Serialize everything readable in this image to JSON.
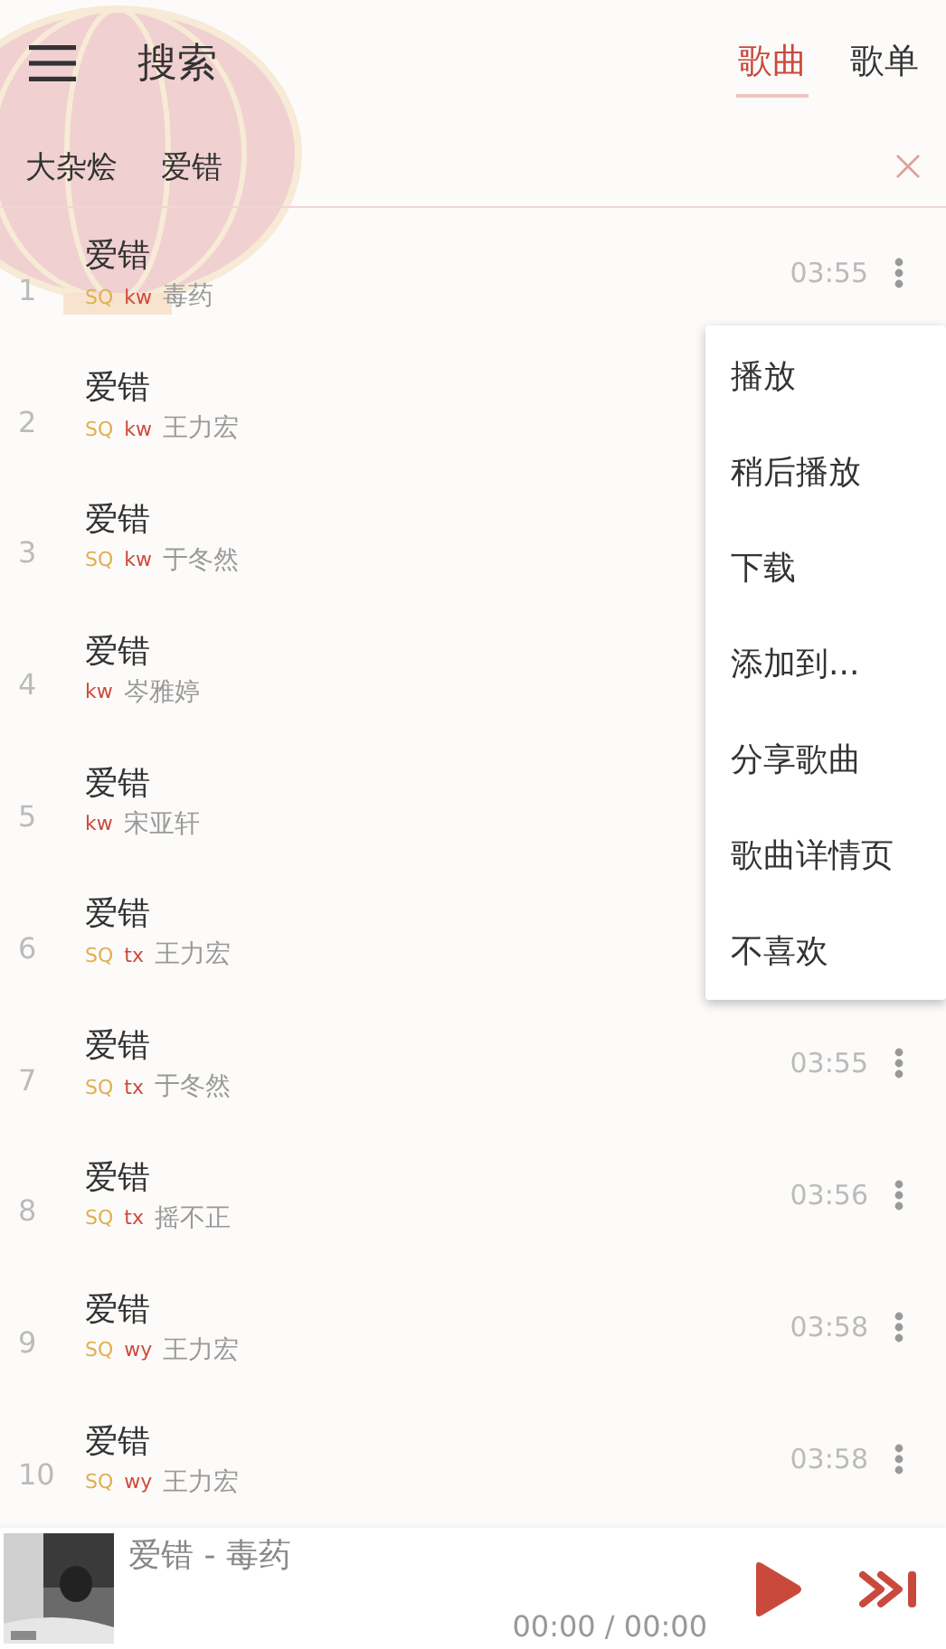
{
  "header": {
    "title": "搜索",
    "tabs": [
      {
        "label": "歌曲",
        "selected": true
      },
      {
        "label": "歌单",
        "selected": false
      }
    ]
  },
  "search_tags": [
    "大杂烩",
    "爱错"
  ],
  "songs": [
    {
      "index": "1",
      "title": "爱错",
      "tags": [
        {
          "kind": "quality",
          "text": "SQ"
        },
        {
          "kind": "source",
          "text": "kw"
        }
      ],
      "artist": "毒药",
      "duration": "03:55"
    },
    {
      "index": "2",
      "title": "爱错",
      "tags": [
        {
          "kind": "quality",
          "text": "SQ"
        },
        {
          "kind": "source",
          "text": "kw"
        }
      ],
      "artist": "王力宏"
    },
    {
      "index": "3",
      "title": "爱错",
      "tags": [
        {
          "kind": "quality",
          "text": "SQ"
        },
        {
          "kind": "source",
          "text": "kw"
        }
      ],
      "artist": "于冬然"
    },
    {
      "index": "4",
      "title": "爱错",
      "tags": [
        {
          "kind": "source",
          "text": "kw"
        }
      ],
      "artist": "岑雅婷"
    },
    {
      "index": "5",
      "title": "爱错",
      "tags": [
        {
          "kind": "source",
          "text": "kw"
        }
      ],
      "artist": "宋亚轩"
    },
    {
      "index": "6",
      "title": "爱错",
      "tags": [
        {
          "kind": "quality",
          "text": "SQ"
        },
        {
          "kind": "source",
          "text": "tx"
        }
      ],
      "artist": "王力宏"
    },
    {
      "index": "7",
      "title": "爱错",
      "tags": [
        {
          "kind": "quality",
          "text": "SQ"
        },
        {
          "kind": "source",
          "text": "tx"
        }
      ],
      "artist": "于冬然",
      "duration": "03:55"
    },
    {
      "index": "8",
      "title": "爱错",
      "tags": [
        {
          "kind": "quality",
          "text": "SQ"
        },
        {
          "kind": "source",
          "text": "tx"
        }
      ],
      "artist": "摇不正",
      "duration": "03:56"
    },
    {
      "index": "9",
      "title": "爱错",
      "tags": [
        {
          "kind": "quality",
          "text": "SQ"
        },
        {
          "kind": "source",
          "text": "wy"
        }
      ],
      "artist": "王力宏",
      "duration": "03:58"
    },
    {
      "index": "10",
      "title": "爱错",
      "tags": [
        {
          "kind": "quality",
          "text": "SQ"
        },
        {
          "kind": "source",
          "text": "wy"
        }
      ],
      "artist": "王力宏",
      "duration": "03:58"
    }
  ],
  "context_menu": {
    "items": [
      "播放",
      "稍后播放",
      "下载",
      "添加到...",
      "分享歌曲",
      "歌曲详情页",
      "不喜欢"
    ]
  },
  "player": {
    "now_playing": "爱错 - 毒药",
    "time": "00:00 / 00:00"
  }
}
